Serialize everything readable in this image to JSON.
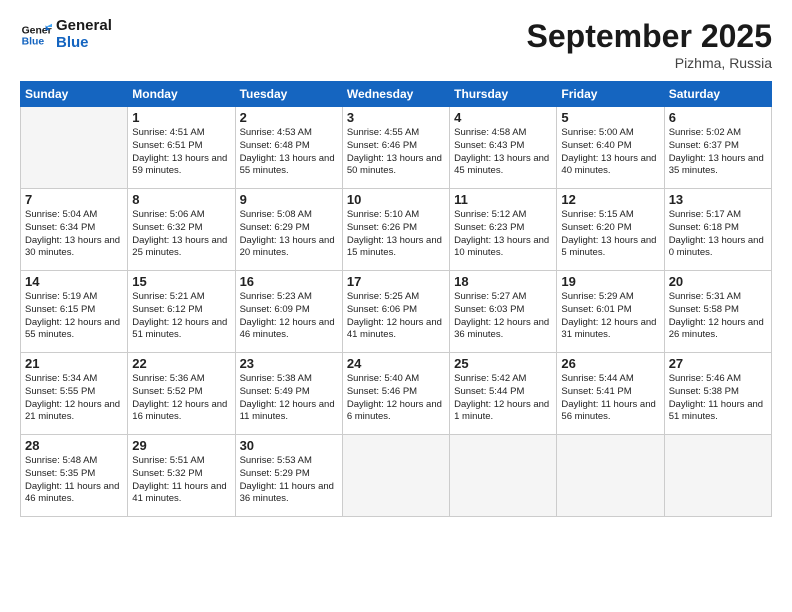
{
  "header": {
    "logo_line1": "General",
    "logo_line2": "Blue",
    "month": "September 2025",
    "location": "Pizhma, Russia"
  },
  "weekdays": [
    "Sunday",
    "Monday",
    "Tuesday",
    "Wednesday",
    "Thursday",
    "Friday",
    "Saturday"
  ],
  "weeks": [
    [
      {
        "day": "",
        "info": ""
      },
      {
        "day": "1",
        "info": "Sunrise: 4:51 AM\nSunset: 6:51 PM\nDaylight: 13 hours\nand 59 minutes."
      },
      {
        "day": "2",
        "info": "Sunrise: 4:53 AM\nSunset: 6:48 PM\nDaylight: 13 hours\nand 55 minutes."
      },
      {
        "day": "3",
        "info": "Sunrise: 4:55 AM\nSunset: 6:46 PM\nDaylight: 13 hours\nand 50 minutes."
      },
      {
        "day": "4",
        "info": "Sunrise: 4:58 AM\nSunset: 6:43 PM\nDaylight: 13 hours\nand 45 minutes."
      },
      {
        "day": "5",
        "info": "Sunrise: 5:00 AM\nSunset: 6:40 PM\nDaylight: 13 hours\nand 40 minutes."
      },
      {
        "day": "6",
        "info": "Sunrise: 5:02 AM\nSunset: 6:37 PM\nDaylight: 13 hours\nand 35 minutes."
      }
    ],
    [
      {
        "day": "7",
        "info": "Sunrise: 5:04 AM\nSunset: 6:34 PM\nDaylight: 13 hours\nand 30 minutes."
      },
      {
        "day": "8",
        "info": "Sunrise: 5:06 AM\nSunset: 6:32 PM\nDaylight: 13 hours\nand 25 minutes."
      },
      {
        "day": "9",
        "info": "Sunrise: 5:08 AM\nSunset: 6:29 PM\nDaylight: 13 hours\nand 20 minutes."
      },
      {
        "day": "10",
        "info": "Sunrise: 5:10 AM\nSunset: 6:26 PM\nDaylight: 13 hours\nand 15 minutes."
      },
      {
        "day": "11",
        "info": "Sunrise: 5:12 AM\nSunset: 6:23 PM\nDaylight: 13 hours\nand 10 minutes."
      },
      {
        "day": "12",
        "info": "Sunrise: 5:15 AM\nSunset: 6:20 PM\nDaylight: 13 hours\nand 5 minutes."
      },
      {
        "day": "13",
        "info": "Sunrise: 5:17 AM\nSunset: 6:18 PM\nDaylight: 13 hours\nand 0 minutes."
      }
    ],
    [
      {
        "day": "14",
        "info": "Sunrise: 5:19 AM\nSunset: 6:15 PM\nDaylight: 12 hours\nand 55 minutes."
      },
      {
        "day": "15",
        "info": "Sunrise: 5:21 AM\nSunset: 6:12 PM\nDaylight: 12 hours\nand 51 minutes."
      },
      {
        "day": "16",
        "info": "Sunrise: 5:23 AM\nSunset: 6:09 PM\nDaylight: 12 hours\nand 46 minutes."
      },
      {
        "day": "17",
        "info": "Sunrise: 5:25 AM\nSunset: 6:06 PM\nDaylight: 12 hours\nand 41 minutes."
      },
      {
        "day": "18",
        "info": "Sunrise: 5:27 AM\nSunset: 6:03 PM\nDaylight: 12 hours\nand 36 minutes."
      },
      {
        "day": "19",
        "info": "Sunrise: 5:29 AM\nSunset: 6:01 PM\nDaylight: 12 hours\nand 31 minutes."
      },
      {
        "day": "20",
        "info": "Sunrise: 5:31 AM\nSunset: 5:58 PM\nDaylight: 12 hours\nand 26 minutes."
      }
    ],
    [
      {
        "day": "21",
        "info": "Sunrise: 5:34 AM\nSunset: 5:55 PM\nDaylight: 12 hours\nand 21 minutes."
      },
      {
        "day": "22",
        "info": "Sunrise: 5:36 AM\nSunset: 5:52 PM\nDaylight: 12 hours\nand 16 minutes."
      },
      {
        "day": "23",
        "info": "Sunrise: 5:38 AM\nSunset: 5:49 PM\nDaylight: 12 hours\nand 11 minutes."
      },
      {
        "day": "24",
        "info": "Sunrise: 5:40 AM\nSunset: 5:46 PM\nDaylight: 12 hours\nand 6 minutes."
      },
      {
        "day": "25",
        "info": "Sunrise: 5:42 AM\nSunset: 5:44 PM\nDaylight: 12 hours\nand 1 minute."
      },
      {
        "day": "26",
        "info": "Sunrise: 5:44 AM\nSunset: 5:41 PM\nDaylight: 11 hours\nand 56 minutes."
      },
      {
        "day": "27",
        "info": "Sunrise: 5:46 AM\nSunset: 5:38 PM\nDaylight: 11 hours\nand 51 minutes."
      }
    ],
    [
      {
        "day": "28",
        "info": "Sunrise: 5:48 AM\nSunset: 5:35 PM\nDaylight: 11 hours\nand 46 minutes."
      },
      {
        "day": "29",
        "info": "Sunrise: 5:51 AM\nSunset: 5:32 PM\nDaylight: 11 hours\nand 41 minutes."
      },
      {
        "day": "30",
        "info": "Sunrise: 5:53 AM\nSunset: 5:29 PM\nDaylight: 11 hours\nand 36 minutes."
      },
      {
        "day": "",
        "info": ""
      },
      {
        "day": "",
        "info": ""
      },
      {
        "day": "",
        "info": ""
      },
      {
        "day": "",
        "info": ""
      }
    ]
  ]
}
